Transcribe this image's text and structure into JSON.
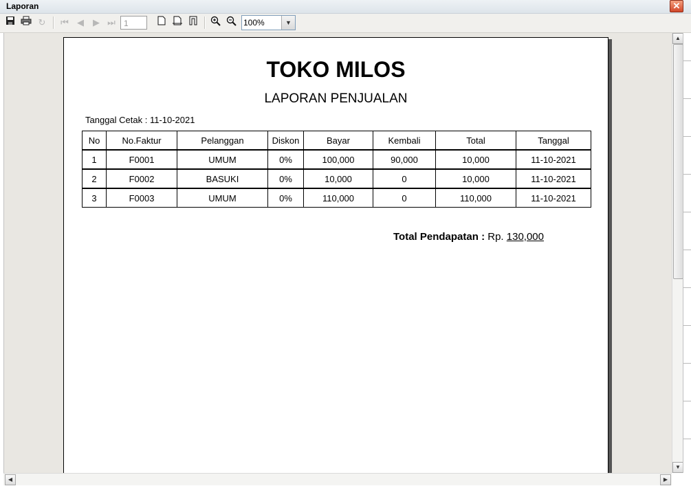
{
  "window": {
    "title": "Laporan",
    "close_glyph": "✕"
  },
  "toolbar": {
    "page_value": "1",
    "zoom_value": "100%",
    "icons": [
      "save-icon",
      "print-icon",
      "refresh-icon",
      "first-page-icon",
      "prev-page-icon",
      "next-page-icon",
      "last-page-icon",
      "page-view-icon",
      "page-width-icon",
      "whole-page-icon",
      "zoom-in-icon",
      "zoom-out-icon",
      "chevron-down-icon"
    ]
  },
  "report": {
    "store_name": "TOKO MILOS",
    "title": "LAPORAN PENJUALAN",
    "print_date": "Tanggal Cetak : 11-10-2021",
    "columns": [
      "No",
      "No.Faktur",
      "Pelanggan",
      "Diskon",
      "Bayar",
      "Kembali",
      "Total",
      "Tanggal"
    ],
    "rows": [
      [
        "1",
        "F0001",
        "UMUM",
        "0%",
        "100,000",
        "90,000",
        "10,000",
        "11-10-2021"
      ],
      [
        "2",
        "F0002",
        "BASUKI",
        "0%",
        "10,000",
        "0",
        "10,000",
        "11-10-2021"
      ],
      [
        "3",
        "F0003",
        "UMUM",
        "0%",
        "110,000",
        "0",
        "110,000",
        "11-10-2021"
      ]
    ],
    "total_label": "Total Pendapatan :",
    "total_prefix": "Rp.",
    "total_value": "130,000"
  }
}
